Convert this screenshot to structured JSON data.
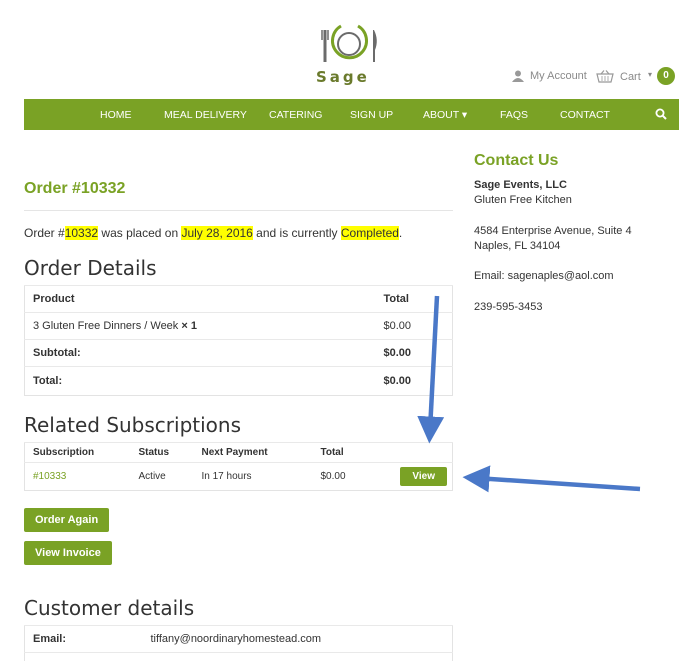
{
  "brand": {
    "name": "Sage"
  },
  "header": {
    "account_label": "My Account",
    "cart_label": "Cart",
    "cart_count": "0"
  },
  "nav": {
    "items": [
      "HOME",
      "MEAL DELIVERY",
      "CATERING",
      "SIGN UP",
      "ABOUT",
      "FAQS",
      "CONTACT"
    ],
    "about_caret": "▾"
  },
  "order": {
    "title": "Order #10332",
    "status_prefix": "Order #",
    "number": "10332",
    "status_mid1": " was placed on ",
    "date": "July 28, 2016",
    "status_mid2": " and is currently ",
    "status": "Completed",
    "status_end": "."
  },
  "order_details": {
    "title": "Order Details",
    "headers": {
      "product": "Product",
      "total": "Total"
    },
    "item_name": "3 Gluten Free Dinners / Week",
    "item_qty": "× 1",
    "item_total": "$0.00",
    "subtotal_label": "Subtotal:",
    "subtotal_value": "$0.00",
    "total_label": "Total:",
    "total_value": "$0.00"
  },
  "subscriptions": {
    "title": "Related Subscriptions",
    "headers": [
      "Subscription",
      "Status",
      "Next Payment",
      "Total"
    ],
    "row": {
      "id": "#10333",
      "status": "Active",
      "next_payment": "In 17 hours",
      "total": "$0.00",
      "action": "View"
    }
  },
  "buttons": {
    "order_again": "Order Again",
    "view_invoice": "View Invoice"
  },
  "customer": {
    "title": "Customer details",
    "email_label": "Email:",
    "email_value": "tiffany@noordinaryhomestead.com"
  },
  "contact": {
    "title": "Contact Us",
    "company": "Sage Events, LLC",
    "tagline": "Gluten Free Kitchen",
    "address1": "4584 Enterprise Avenue, Suite 4",
    "address2": "Naples, FL 34104",
    "email": "Email: sagenaples@aol.com",
    "phone": "239-595-3453"
  },
  "colors": {
    "accent": "#7aa225",
    "highlight": "#ffff00",
    "arrow": "#4a78c8"
  }
}
